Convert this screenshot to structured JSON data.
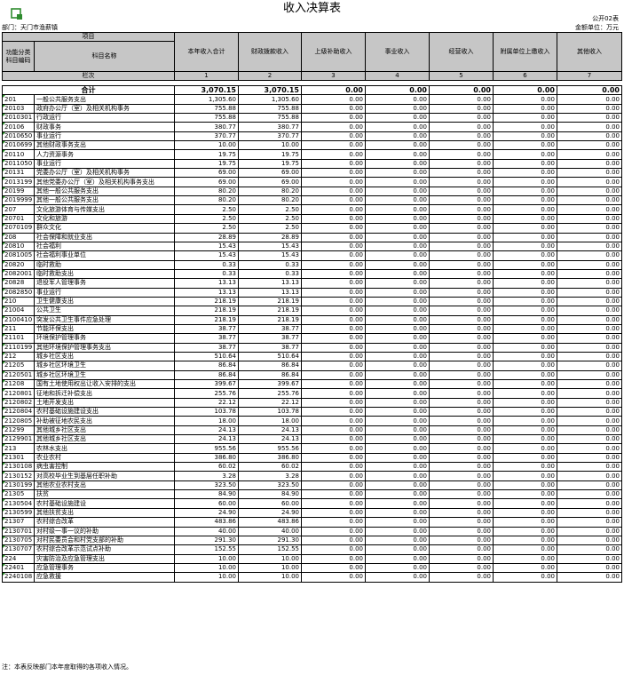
{
  "title": "收入决算表",
  "form_code": "公开02表",
  "department": "部门：天门市渔薪镇",
  "unit": "金额单位：万元",
  "header": {
    "project": "项目",
    "func_code": "功能分类科目编码",
    "item_name": "科目名称",
    "col_labels": [
      "本年收入合计",
      "财政拨款收入",
      "上级补助收入",
      "事业收入",
      "经营收入",
      "附属单位上缴收入",
      "其他收入"
    ],
    "row_label": "栏次",
    "col_numbers": [
      "1",
      "2",
      "3",
      "4",
      "5",
      "6",
      "7"
    ]
  },
  "total": {
    "label": "合计",
    "values": [
      "3,070.15",
      "3,070.15",
      "0.00",
      "0.00",
      "0.00",
      "0.00",
      "0.00"
    ]
  },
  "rows": [
    {
      "code": "201",
      "name": "一般公共服务支出",
      "total": "1,305.60",
      "fiscal": "1,305.60"
    },
    {
      "code": "20103",
      "name": "政府办公厅（室）及相关机构事务",
      "total": "755.88",
      "fiscal": "755.88"
    },
    {
      "code": "2010301",
      "name": "行政运行",
      "total": "755.88",
      "fiscal": "755.88"
    },
    {
      "code": "20106",
      "name": "财政事务",
      "total": "380.77",
      "fiscal": "380.77"
    },
    {
      "code": "2010650",
      "name": "事业运行",
      "total": "370.77",
      "fiscal": "370.77"
    },
    {
      "code": "2010699",
      "name": "其他财政事务支出",
      "total": "10.00",
      "fiscal": "10.00"
    },
    {
      "code": "20110",
      "name": "人力资源事务",
      "total": "19.75",
      "fiscal": "19.75"
    },
    {
      "code": "2011050",
      "name": "事业运行",
      "total": "19.75",
      "fiscal": "19.75"
    },
    {
      "code": "20131",
      "name": "党委办公厅（室）及相关机构事务",
      "total": "69.00",
      "fiscal": "69.00"
    },
    {
      "code": "2013199",
      "name": "其他党委办公厅（室）及相关机构事务支出",
      "total": "69.00",
      "fiscal": "69.00"
    },
    {
      "code": "20199",
      "name": "其他一般公共服务支出",
      "total": "80.20",
      "fiscal": "80.20"
    },
    {
      "code": "2019999",
      "name": "其他一般公共服务支出",
      "total": "80.20",
      "fiscal": "80.20"
    },
    {
      "code": "207",
      "name": "文化旅游体育与传媒支出",
      "total": "2.50",
      "fiscal": "2.50"
    },
    {
      "code": "20701",
      "name": "文化和旅游",
      "total": "2.50",
      "fiscal": "2.50"
    },
    {
      "code": "2070109",
      "name": "群众文化",
      "total": "2.50",
      "fiscal": "2.50"
    },
    {
      "code": "208",
      "name": "社会保障和就业支出",
      "total": "28.89",
      "fiscal": "28.89"
    },
    {
      "code": "20810",
      "name": "社会福利",
      "total": "15.43",
      "fiscal": "15.43"
    },
    {
      "code": "2081005",
      "name": "社会福利事业单位",
      "total": "15.43",
      "fiscal": "15.43"
    },
    {
      "code": "20820",
      "name": "临时救助",
      "total": "0.33",
      "fiscal": "0.33"
    },
    {
      "code": "2082001",
      "name": "临时救助支出",
      "total": "0.33",
      "fiscal": "0.33"
    },
    {
      "code": "20828",
      "name": "退役军人管理事务",
      "total": "13.13",
      "fiscal": "13.13"
    },
    {
      "code": "2082850",
      "name": "事业运行",
      "total": "13.13",
      "fiscal": "13.13"
    },
    {
      "code": "210",
      "name": "卫生健康支出",
      "total": "218.19",
      "fiscal": "218.19"
    },
    {
      "code": "21004",
      "name": "公共卫生",
      "total": "218.19",
      "fiscal": "218.19"
    },
    {
      "code": "2100410",
      "name": "突发公共卫生事件应急处理",
      "total": "218.19",
      "fiscal": "218.19"
    },
    {
      "code": "211",
      "name": "节能环保支出",
      "total": "38.77",
      "fiscal": "38.77"
    },
    {
      "code": "21101",
      "name": "环境保护管理事务",
      "total": "38.77",
      "fiscal": "38.77"
    },
    {
      "code": "2110199",
      "name": "其他环境保护管理事务支出",
      "total": "38.77",
      "fiscal": "38.77"
    },
    {
      "code": "212",
      "name": "城乡社区支出",
      "total": "510.64",
      "fiscal": "510.64"
    },
    {
      "code": "21205",
      "name": "城乡社区环境卫生",
      "total": "86.84",
      "fiscal": "86.84"
    },
    {
      "code": "2120501",
      "name": "城乡社区环境卫生",
      "total": "86.84",
      "fiscal": "86.84"
    },
    {
      "code": "21208",
      "name": "国有土地使用权出让收入安排的支出",
      "total": "399.67",
      "fiscal": "399.67"
    },
    {
      "code": "2120801",
      "name": "征地和拆迁补偿支出",
      "total": "255.76",
      "fiscal": "255.76"
    },
    {
      "code": "2120802",
      "name": "土地开发支出",
      "total": "22.12",
      "fiscal": "22.12"
    },
    {
      "code": "2120804",
      "name": "农村基础设施建设支出",
      "total": "103.78",
      "fiscal": "103.78"
    },
    {
      "code": "2120805",
      "name": "补助被征地农民支出",
      "total": "18.00",
      "fiscal": "18.00"
    },
    {
      "code": "21299",
      "name": "其他城乡社区支出",
      "total": "24.13",
      "fiscal": "24.13"
    },
    {
      "code": "2129901",
      "name": "其他城乡社区支出",
      "total": "24.13",
      "fiscal": "24.13"
    },
    {
      "code": "213",
      "name": "农林水支出",
      "total": "955.56",
      "fiscal": "955.56"
    },
    {
      "code": "21301",
      "name": "农业农村",
      "total": "386.80",
      "fiscal": "386.80"
    },
    {
      "code": "2130108",
      "name": "病虫害控制",
      "total": "60.02",
      "fiscal": "60.02"
    },
    {
      "code": "2130152",
      "name": "对高校毕业生到基层任职补助",
      "total": "3.28",
      "fiscal": "3.28"
    },
    {
      "code": "2130199",
      "name": "其他农业农村支出",
      "total": "323.50",
      "fiscal": "323.50"
    },
    {
      "code": "21305",
      "name": "扶贫",
      "total": "84.90",
      "fiscal": "84.90"
    },
    {
      "code": "2130504",
      "name": "农村基础设施建设",
      "total": "60.00",
      "fiscal": "60.00"
    },
    {
      "code": "2130599",
      "name": "其他扶贫支出",
      "total": "24.90",
      "fiscal": "24.90"
    },
    {
      "code": "21307",
      "name": "农村综合改革",
      "total": "483.86",
      "fiscal": "483.86"
    },
    {
      "code": "2130701",
      "name": "对村级一事一议的补助",
      "total": "40.00",
      "fiscal": "40.00"
    },
    {
      "code": "2130705",
      "name": "对村民委员会和村党支部的补助",
      "total": "291.30",
      "fiscal": "291.30"
    },
    {
      "code": "2130707",
      "name": "农村综合改革示范试点补助",
      "total": "152.55",
      "fiscal": "152.55"
    },
    {
      "code": "224",
      "name": "灾害防治及应急管理支出",
      "total": "10.00",
      "fiscal": "10.00"
    },
    {
      "code": "22401",
      "name": "应急管理事务",
      "total": "10.00",
      "fiscal": "10.00"
    },
    {
      "code": "2240108",
      "name": "应急救援",
      "total": "10.00",
      "fiscal": "10.00"
    }
  ],
  "zero_value": "0.00",
  "note": "注：本表反映部门本年度取得的各项收入情况。",
  "colors": {
    "header_bg": "#c6c6c6",
    "border": "#000000",
    "corner_mark": "#1e8c1e"
  },
  "icons": {
    "top_left": "spreadsheet-corner-icon"
  }
}
